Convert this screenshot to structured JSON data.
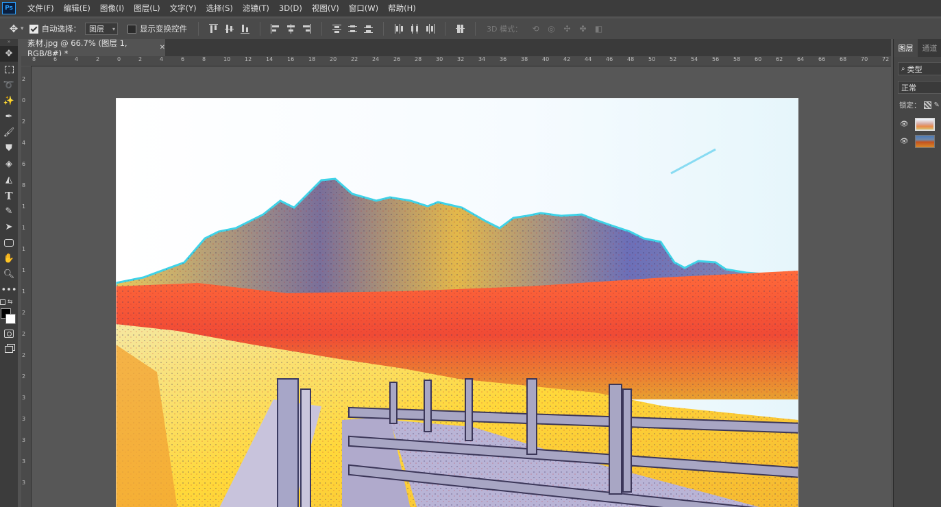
{
  "app": {
    "logo": "Ps"
  },
  "menu": [
    "文件(F)",
    "编辑(E)",
    "图像(I)",
    "图层(L)",
    "文字(Y)",
    "选择(S)",
    "滤镜(T)",
    "3D(D)",
    "视图(V)",
    "窗口(W)",
    "帮助(H)"
  ],
  "options": {
    "auto_select_label": "自动选择：",
    "auto_select_checked": true,
    "auto_select_value": "图层",
    "show_transform_label": "显示变换控件",
    "show_transform_checked": false,
    "mode_3d_label": "3D 模式："
  },
  "document": {
    "tab_title": "素材.jpg @ 66.7% (图层 1, RGB/8#) *",
    "zoom": "66.7%"
  },
  "rulers": {
    "top": [
      "8",
      "6",
      "4",
      "2",
      "0",
      "2",
      "4",
      "6",
      "8",
      "10",
      "12",
      "14",
      "16",
      "18",
      "20",
      "22",
      "24",
      "26",
      "28",
      "30",
      "32",
      "34",
      "36",
      "38",
      "40",
      "42",
      "44",
      "46",
      "48",
      "50",
      "52",
      "54",
      "56",
      "58",
      "60",
      "62",
      "64",
      "66",
      "68",
      "70",
      "72"
    ],
    "left": [
      "2",
      "0",
      "2",
      "4",
      "6",
      "8",
      "1",
      "1",
      "1",
      "1",
      "1",
      "2",
      "2",
      "2",
      "2",
      "3",
      "3",
      "3",
      "3",
      "3"
    ]
  },
  "tools": [
    "move-tool",
    "marquee-tool",
    "lasso-tool",
    "magic-wand-tool",
    "eyedropper-tool",
    "brush-tool",
    "stamp-tool",
    "eraser-tool",
    "paint-bucket-tool",
    "type-tool",
    "pen-tool",
    "path-select-tool",
    "shape-tool",
    "hand-tool",
    "zoom-tool",
    "more-tools"
  ],
  "colors": {
    "foreground": "#000000",
    "background": "#ffffff",
    "accent": "#2aa0ff"
  },
  "layers_panel": {
    "tabs": [
      "图层",
      "通道"
    ],
    "filter_label": "类型",
    "blend_mode": "正常",
    "lock_label": "锁定："
  },
  "layers": [
    {
      "visible": true,
      "selected": true
    },
    {
      "visible": true,
      "selected": false
    }
  ]
}
